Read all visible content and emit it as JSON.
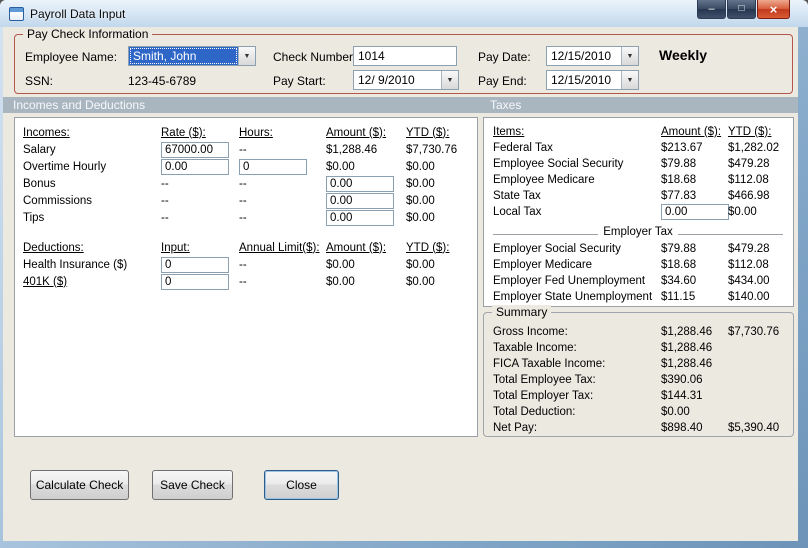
{
  "window": {
    "title": "Payroll Data Input"
  },
  "icons": {
    "minimize": "–",
    "maximize": "□",
    "close": "×",
    "dropdown": "▼"
  },
  "colors": {
    "selection_blue": "#2E66C8",
    "paycheck_group_border": "#B4574B",
    "section_band": "#A9B6C0",
    "window_background": "#ECE9E0",
    "close_button_red": "#C13A20"
  },
  "paycheck": {
    "legend": "Pay Check Information",
    "employee_name": {
      "label": "Employee Name:",
      "value": "Smith, John"
    },
    "ssn": {
      "label": "SSN:",
      "value": "123-45-6789"
    },
    "check_number": {
      "label": "Check Number:",
      "value": "1014"
    },
    "pay_start": {
      "label": "Pay Start:",
      "value": "12/ 9/2010"
    },
    "pay_date": {
      "label": "Pay Date:",
      "value": "12/15/2010"
    },
    "pay_end": {
      "label": "Pay End:",
      "value": "12/15/2010"
    },
    "frequency": "Weekly"
  },
  "section_headers": {
    "left": "Incomes and Deductions",
    "right": "Taxes"
  },
  "incomes": {
    "headers": {
      "col0": "Incomes:",
      "col1": "Rate ($):",
      "col2": "Hours:",
      "col3": "Amount ($):",
      "col4": "YTD ($):"
    },
    "rows": [
      {
        "label": "Salary",
        "rate": "67000.00",
        "hours": "--",
        "amount": "$1,288.46",
        "ytd": "$7,730.76"
      },
      {
        "label": "Overtime Hourly",
        "rate": "0.00",
        "hours": "0",
        "amount": "$0.00",
        "ytd": "$0.00"
      },
      {
        "label": "Bonus",
        "rate": "--",
        "hours": "--",
        "amount": "0.00",
        "ytd": "$0.00"
      },
      {
        "label": "Commissions",
        "rate": "--",
        "hours": "--",
        "amount": "0.00",
        "ytd": "$0.00"
      },
      {
        "label": "Tips",
        "rate": "--",
        "hours": "--",
        "amount": "0.00",
        "ytd": "$0.00"
      }
    ]
  },
  "deductions": {
    "headers": {
      "col0": "Deductions:",
      "col1": "Input:",
      "col2": "Annual Limit($):",
      "col3": "Amount ($):",
      "col4": "YTD ($):"
    },
    "rows": [
      {
        "label": "Health Insurance  ($)",
        "input": "0",
        "limit": "--",
        "amount": "$0.00",
        "ytd": "$0.00"
      },
      {
        "label": "401K  ($)",
        "input": "0",
        "limit": "--",
        "amount": "$0.00",
        "ytd": "$0.00"
      }
    ]
  },
  "taxes": {
    "headers": {
      "item": "Items:",
      "amount": "Amount ($):",
      "ytd": "YTD ($):"
    },
    "employee_rows": [
      {
        "label": "Federal Tax",
        "amount": "$213.67",
        "ytd": "$1,282.02"
      },
      {
        "label": "Employee Social Security",
        "amount": "$79.88",
        "ytd": "$479.28"
      },
      {
        "label": "Employee Medicare",
        "amount": "$18.68",
        "ytd": "$112.08"
      },
      {
        "label": "State Tax",
        "amount": "$77.83",
        "ytd": "$466.98"
      }
    ],
    "local_tax": {
      "label": "Local Tax",
      "amount": "0.00",
      "ytd": "$0.00"
    },
    "employer_separator": "Employer Tax",
    "employer_rows": [
      {
        "label": "Employer Social Security",
        "amount": "$79.88",
        "ytd": "$479.28"
      },
      {
        "label": "Employer Medicare",
        "amount": "$18.68",
        "ytd": "$112.08"
      },
      {
        "label": "Employer Fed Unemployment",
        "amount": "$34.60",
        "ytd": "$434.00"
      },
      {
        "label": "Employer State Unemployment",
        "amount": "$11.15",
        "ytd": "$140.00"
      }
    ]
  },
  "summary": {
    "legend": "Summary",
    "rows": [
      {
        "label": "Gross Income:",
        "amount": "$1,288.46",
        "ytd": "$7,730.76"
      },
      {
        "label": "Taxable Income:",
        "amount": "$1,288.46",
        "ytd": ""
      },
      {
        "label": "FICA Taxable Income:",
        "amount": "$1,288.46",
        "ytd": ""
      },
      {
        "label": "Total Employee Tax:",
        "amount": "$390.06",
        "ytd": ""
      },
      {
        "label": "Total Employer Tax:",
        "amount": "$144.31",
        "ytd": ""
      },
      {
        "label": "Total Deduction:",
        "amount": "$0.00",
        "ytd": ""
      },
      {
        "label": "Net Pay:",
        "amount": "$898.40",
        "ytd": "$5,390.40"
      }
    ]
  },
  "buttons": {
    "calculate": "Calculate Check",
    "save": "Save Check",
    "close": "Close"
  }
}
